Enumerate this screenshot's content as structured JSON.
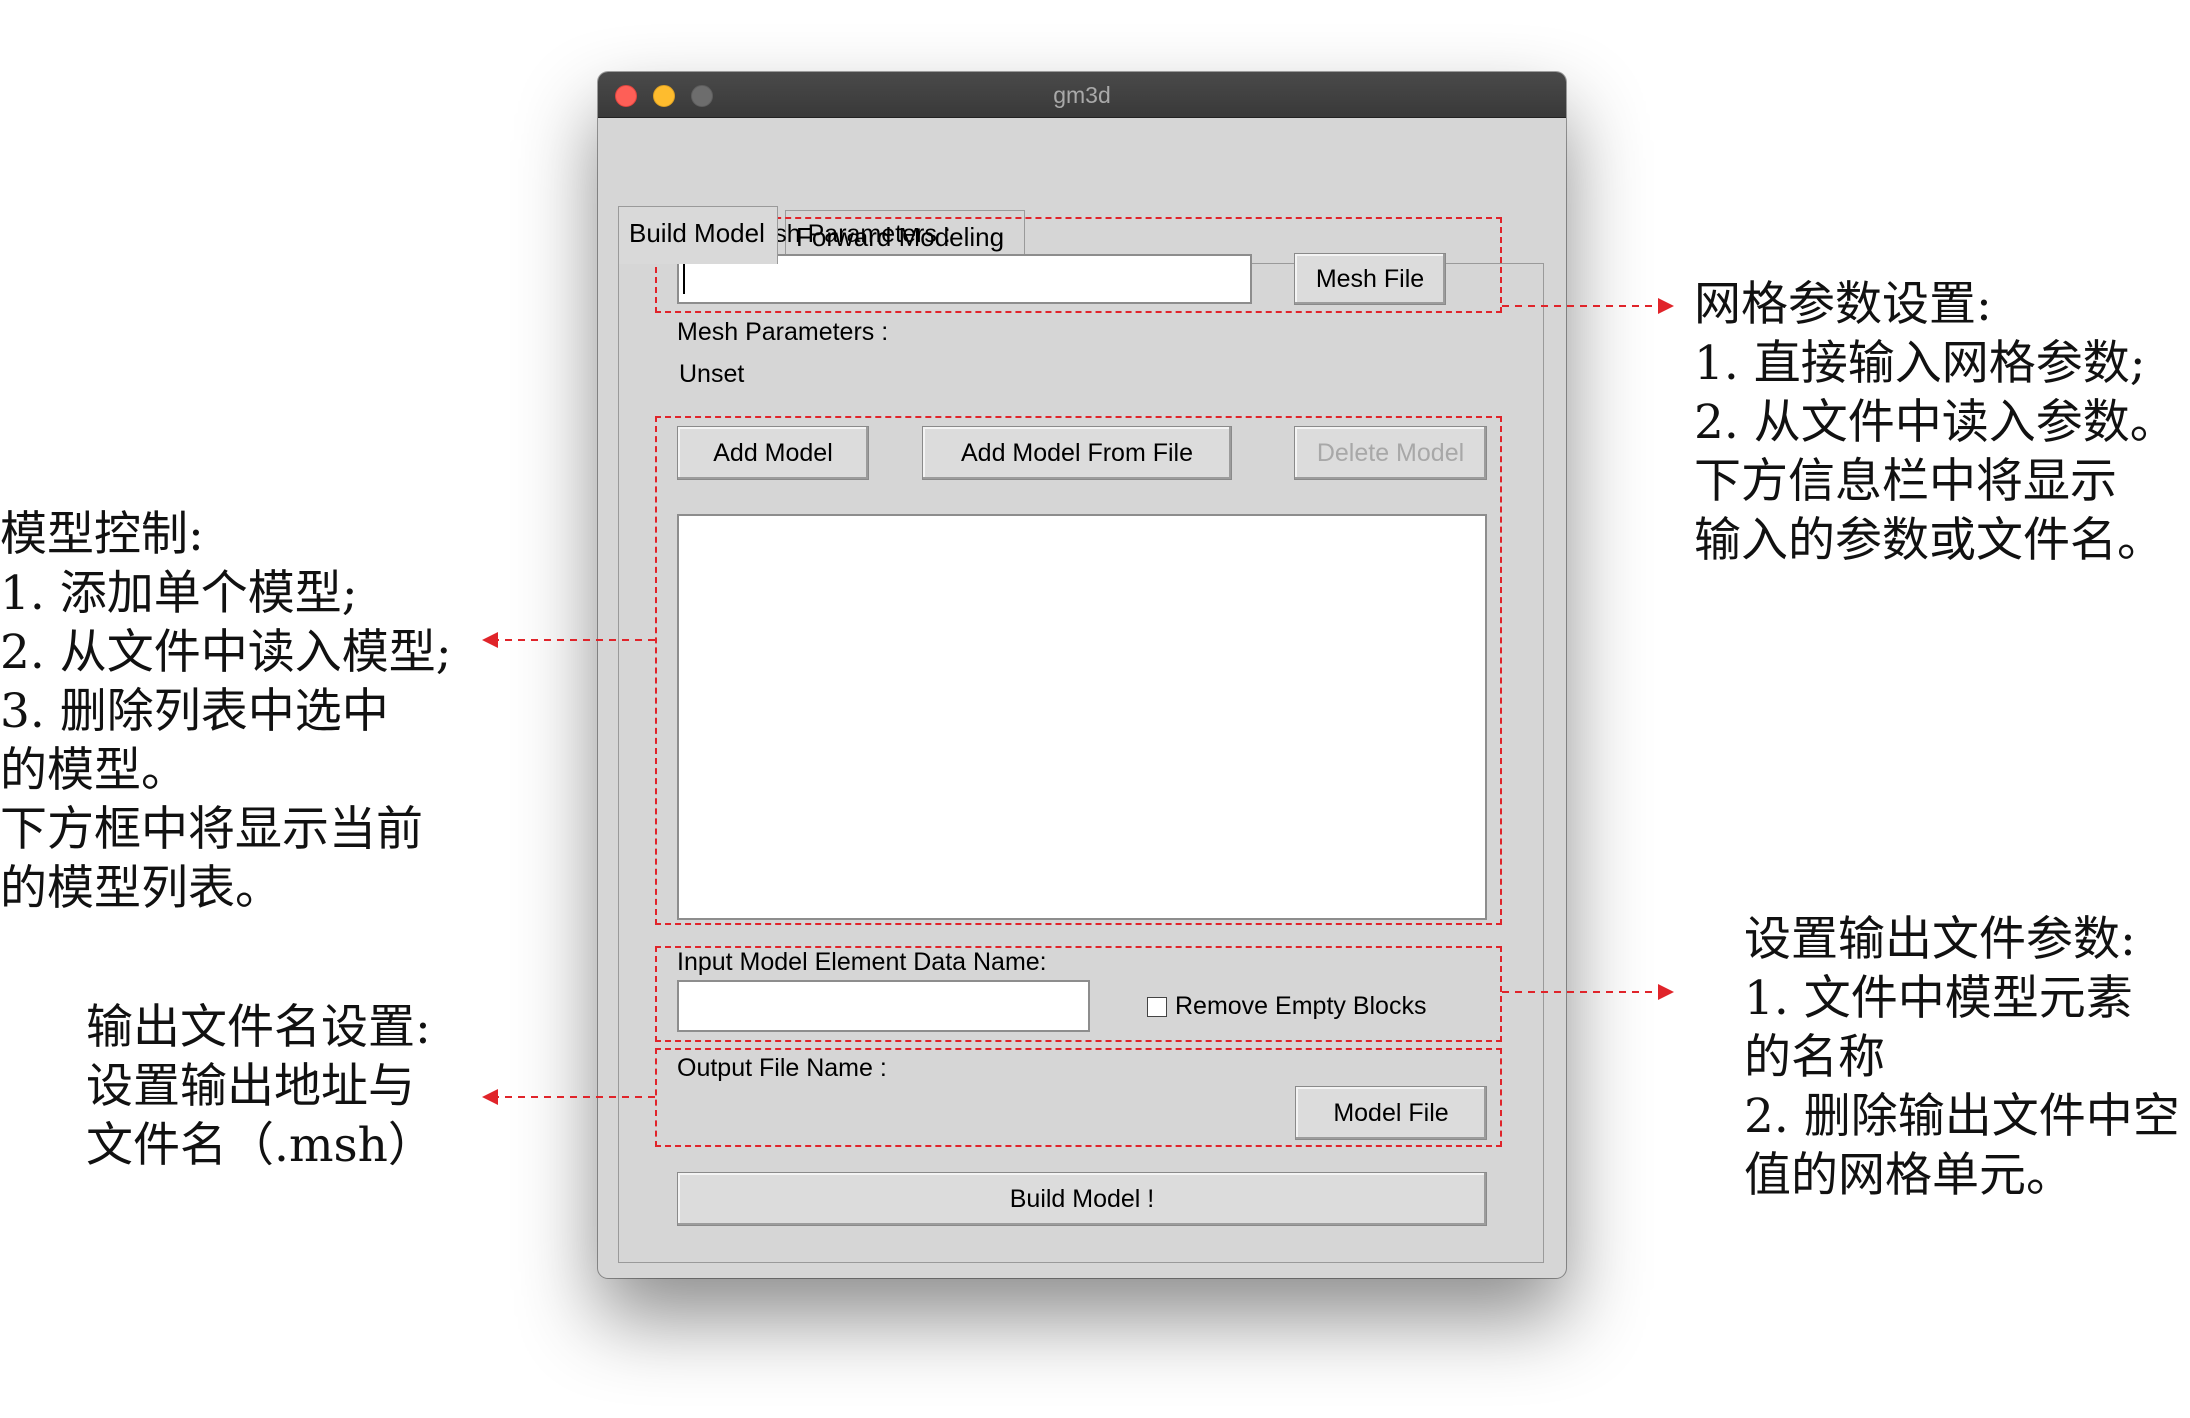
{
  "window": {
    "title": "gm3d"
  },
  "tabs": [
    {
      "label": "Build Model",
      "active": true
    },
    {
      "label": "Forward Modeling",
      "active": false
    }
  ],
  "mesh": {
    "input_label": "Input Mesh Parameters :",
    "input_value": "",
    "mesh_file_button": "Mesh File",
    "params_label": "Mesh Parameters :",
    "params_value": "Unset"
  },
  "models": {
    "add_button": "Add Model",
    "add_from_file_button": "Add Model From File",
    "delete_button": "Delete Model",
    "list_items": []
  },
  "output": {
    "element_label": "Input Model Element Data Name:",
    "element_value": "",
    "remove_empty_label": "Remove Empty Blocks",
    "remove_empty_checked": false,
    "file_name_label": "Output File Name :",
    "model_file_button": "Model File",
    "build_button": "Build Model !"
  },
  "annotations": {
    "mesh_note": [
      "网格参数设置:",
      "1. 直接输入网格参数;",
      "2. 从文件中读入参数。",
      "下方信息栏中将显示",
      "输入的参数或文件名。"
    ],
    "model_note": [
      "模型控制:",
      "1. 添加单个模型;",
      "2. 从文件中读入模型;",
      "3. 删除列表中选中",
      "的模型。",
      "下方框中将显示当前",
      "的模型列表。"
    ],
    "output_params_note": [
      "设置输出文件参数:",
      "1. 文件中模型元素",
      "的名称",
      "2. 删除输出文件中空",
      "值的网格单元。"
    ],
    "output_name_note": [
      "输出文件名设置:",
      "设置输出地址与",
      "文件名（.msh）"
    ]
  },
  "colors": {
    "annotation_dash": "#e0242a",
    "window_bg": "#d6d6d6",
    "titlebar": "#3d3d3d"
  }
}
